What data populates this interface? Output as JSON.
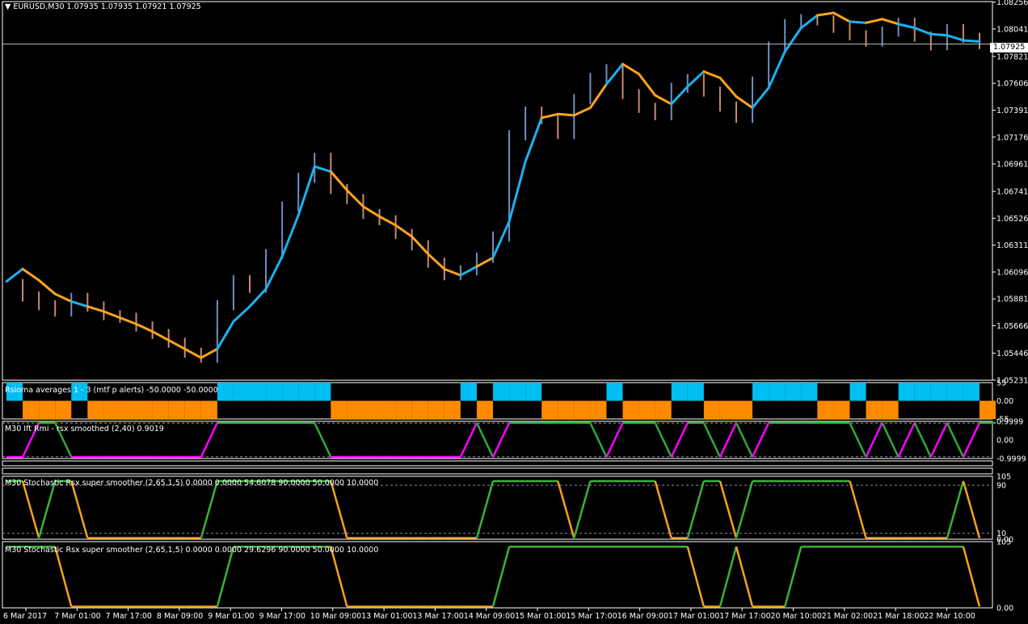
{
  "header": {
    "symbol_line": "EURUSD,M30  1.07935 1.07935 1.07921 1.07925",
    "current_price_label": "1.07925"
  },
  "colors": {
    "background": "#000000",
    "grid_border": "#ffffff",
    "bull_bars": "#6f8fc2",
    "bear_bars": "#c98a6e",
    "trend_up": "#1ab2ef",
    "trend_down": "#ffa31a",
    "oscillator_up": "#2ea83a",
    "oscillator_down": "#ff00ff",
    "stoch_up": "#36b536",
    "stoch_down": "#f7a01e",
    "histo_up": "#00bdf2",
    "histo_down": "#ff8a00"
  },
  "chart_data": [
    {
      "type": "line",
      "name": "main-price",
      "ylim": [
        1.0523,
        1.0826
      ],
      "y_tick_labels": [
        "1.08256",
        "1.08041",
        "1.07821",
        "1.07606",
        "1.07391",
        "1.07176",
        "1.06961",
        "1.06741",
        "1.06526",
        "1.06311",
        "1.06096",
        "1.05881",
        "1.05666",
        "1.05446",
        "1.05231"
      ],
      "x_tick_labels": [
        "6 Mar 2017",
        "7 Mar 01:00",
        "7 Mar 17:00",
        "8 Mar 09:00",
        "9 Mar 01:00",
        "9 Mar 17:00",
        "10 Mar 09:00",
        "13 Mar 01:00",
        "13 Mar 17:00",
        "14 Mar 09:00",
        "15 Mar 01:00",
        "15 Mar 17:00",
        "16 Mar 09:00",
        "17 Mar 01:00",
        "17 Mar 17:00",
        "20 Mar 10:00",
        "21 Mar 02:00",
        "21 Mar 18:00",
        "22 Mar 10:00"
      ],
      "x_steps": [
        0,
        1,
        2,
        3,
        4,
        5,
        6,
        7,
        8,
        9,
        10,
        11,
        12,
        13,
        14,
        15,
        16,
        17,
        18,
        19,
        20,
        21,
        22,
        23,
        24,
        25,
        26,
        27,
        28,
        29,
        30,
        31,
        32,
        33,
        34,
        35,
        36,
        37,
        38,
        39,
        40,
        41,
        42,
        43,
        44,
        45,
        46,
        47,
        48,
        49,
        50,
        51,
        52,
        53,
        54,
        55,
        56,
        57,
        58,
        59,
        60
      ],
      "series": [
        {
          "name": "close",
          "values": [
            1.06,
            1.059,
            1.0583,
            1.0578,
            1.0589,
            1.0582,
            1.0575,
            1.0573,
            1.0566,
            1.056,
            1.0553,
            1.0545,
            1.0541,
            1.0583,
            1.0603,
            1.0597,
            1.0624,
            1.0662,
            1.0685,
            1.0701,
            1.0676,
            1.0668,
            1.0656,
            1.0651,
            1.064,
            1.0631,
            1.0617,
            1.0607,
            1.0611,
            1.0621,
            1.0638,
            1.0719,
            1.0738,
            1.0732,
            1.072,
            1.0748,
            1.0765,
            1.0772,
            1.0752,
            1.0741,
            1.0735,
            1.0757,
            1.0764,
            1.0754,
            1.0742,
            1.0733,
            1.0762,
            1.079,
            1.0808,
            1.0812,
            1.0811,
            1.0805,
            1.0799,
            1.0794,
            1.0802,
            1.0809,
            1.0798,
            1.0791,
            1.0804,
            1.0797,
            1.0792
          ]
        },
        {
          "name": "trend",
          "values": [
            1.0602,
            1.0612,
            1.0603,
            1.0592,
            1.0586,
            1.0582,
            1.0578,
            1.0573,
            1.0568,
            1.0562,
            1.0555,
            1.0548,
            1.0541,
            1.0548,
            1.057,
            1.0582,
            1.0596,
            1.0622,
            1.0655,
            1.0694,
            1.069,
            1.0675,
            1.0662,
            1.0654,
            1.0647,
            1.0638,
            1.0624,
            1.0612,
            1.0607,
            1.0614,
            1.0621,
            1.065,
            1.0698,
            1.0733,
            1.0736,
            1.0735,
            1.0741,
            1.076,
            1.0776,
            1.0768,
            1.0751,
            1.0744,
            1.0758,
            1.077,
            1.0765,
            1.075,
            1.0741,
            1.0757,
            1.0786,
            1.0805,
            1.0815,
            1.0817,
            1.081,
            1.0809,
            1.0812,
            1.0808,
            1.0805,
            1.08,
            1.0799,
            1.0795,
            1.0794
          ]
        }
      ],
      "trend_state": [
        0,
        1,
        1,
        1,
        0,
        1,
        1,
        1,
        1,
        1,
        1,
        1,
        1,
        0,
        0,
        0,
        0,
        0,
        0,
        0,
        1,
        1,
        1,
        1,
        1,
        1,
        1,
        1,
        0,
        1,
        0,
        0,
        0,
        1,
        1,
        1,
        1,
        0,
        1,
        1,
        1,
        0,
        0,
        1,
        1,
        1,
        0,
        0,
        0,
        0,
        1,
        1,
        0,
        1,
        1,
        0,
        0,
        0,
        0,
        0,
        0
      ]
    },
    {
      "type": "bar",
      "name": "rsioma-histogram",
      "title": "Rsioma averages 1 - 3 (mtf p alerts) -50.0000 -50.0000",
      "y_tick_labels": [
        "55",
        "0.00",
        "-55"
      ],
      "ylim": [
        -55,
        55
      ],
      "state": [
        0,
        1,
        1,
        1,
        0,
        1,
        1,
        1,
        1,
        1,
        1,
        1,
        1,
        0,
        0,
        0,
        0,
        0,
        0,
        0,
        1,
        1,
        1,
        1,
        1,
        1,
        1,
        1,
        0,
        1,
        0,
        0,
        0,
        1,
        1,
        1,
        1,
        0,
        1,
        1,
        1,
        0,
        0,
        1,
        1,
        1,
        0,
        0,
        0,
        0,
        1,
        1,
        0,
        1,
        1,
        0,
        0,
        0,
        0,
        0,
        1
      ]
    },
    {
      "type": "line",
      "name": "ift-rmi",
      "title": "M30 Ift Rmi - rsx smoothed (2,40) 0.9019",
      "y_tick_labels": [
        "0.9999",
        "0.00",
        "-0.9999"
      ],
      "ylim": [
        -1,
        1
      ],
      "state": [
        0,
        0,
        1,
        1,
        0,
        0,
        0,
        0,
        0,
        0,
        0,
        0,
        0,
        1,
        1,
        1,
        1,
        1,
        1,
        1,
        0,
        0,
        0,
        0,
        0,
        0,
        0,
        0,
        0,
        1,
        0,
        1,
        1,
        1,
        1,
        1,
        1,
        0,
        1,
        1,
        1,
        0,
        1,
        1,
        0,
        1,
        0,
        1,
        1,
        1,
        1,
        1,
        1,
        0,
        1,
        0,
        1,
        0,
        1,
        0,
        1
      ]
    },
    {
      "type": "line",
      "name": "stochastic-1",
      "title": "M30 Stochastic Rsx super smoother (2,65,1,5) 0.0000 0.0000 54.6078 90.0000 50.0000 10.0000",
      "y_tick_labels": [
        "105",
        "90",
        "10",
        "0.00"
      ],
      "ylim": [
        0,
        105
      ],
      "values": [
        100,
        100,
        0,
        100,
        100,
        0,
        0,
        0,
        0,
        0,
        0,
        0,
        0,
        100,
        100,
        100,
        100,
        100,
        100,
        100,
        100,
        0,
        0,
        0,
        0,
        0,
        0,
        0,
        0,
        0,
        100,
        100,
        100,
        100,
        100,
        0,
        100,
        100,
        100,
        100,
        100,
        0,
        0,
        100,
        100,
        0,
        100,
        100,
        100,
        100,
        100,
        100,
        100,
        0,
        0,
        0,
        0,
        0,
        0,
        100,
        0
      ]
    },
    {
      "type": "line",
      "name": "stochastic-2",
      "title": "M30 Stochastic Rsx super smoother (2,65,1,5) 0.0000 0.0000 29.6296 90.0000 50.0000 10.0000",
      "y_tick_labels": [
        "105",
        "0.00"
      ],
      "ylim": [
        0,
        105
      ],
      "values": [
        100,
        100,
        100,
        100,
        0,
        0,
        0,
        0,
        0,
        0,
        0,
        0,
        0,
        0,
        100,
        100,
        100,
        100,
        100,
        100,
        100,
        0,
        0,
        0,
        0,
        0,
        0,
        0,
        0,
        0,
        0,
        100,
        100,
        100,
        100,
        100,
        100,
        100,
        100,
        100,
        100,
        100,
        100,
        0,
        0,
        100,
        0,
        0,
        0,
        100,
        100,
        100,
        100,
        100,
        100,
        100,
        100,
        100,
        100,
        100,
        0
      ]
    }
  ]
}
